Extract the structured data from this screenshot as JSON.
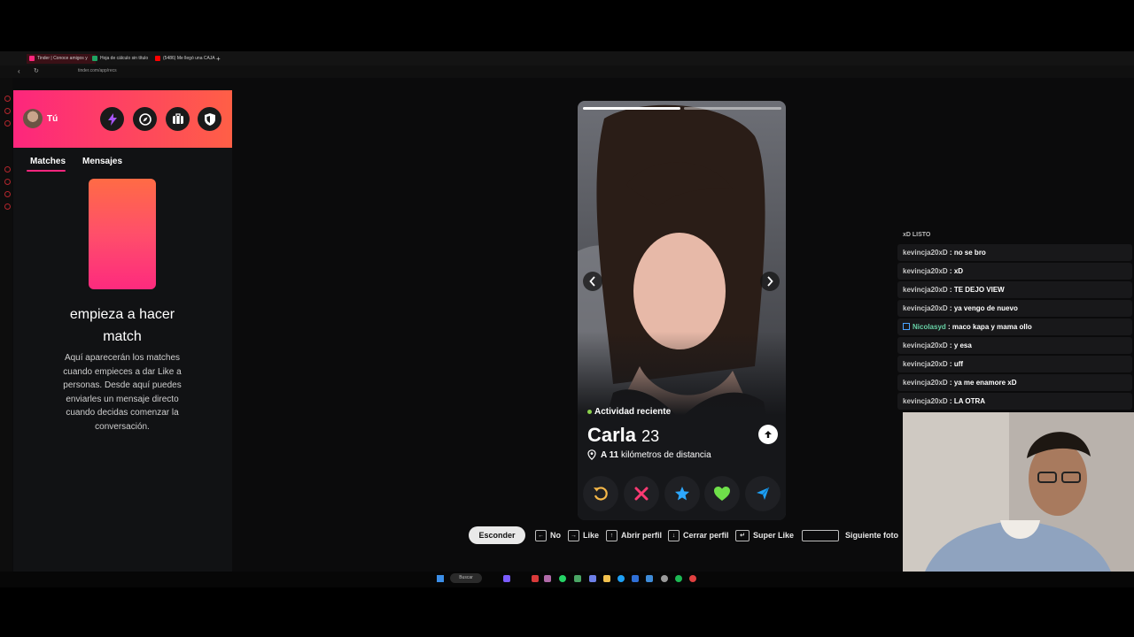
{
  "browser": {
    "tabs": [
      {
        "label": "Tinder | Conoce amigos y"
      },
      {
        "label": "Hoja de cálculo sin título"
      },
      {
        "label": "(5486) Me llegó una CAJA"
      }
    ],
    "new_tab": "+",
    "url": "tinder.com/app/recs"
  },
  "sidebar": {
    "profile_name": "Tú",
    "tabs": {
      "matches": "Matches",
      "messages": "Mensajes"
    },
    "empty_title": "empieza a hacer match",
    "empty_text": "Aquí aparecerán los matches cuando empieces a dar Like a personas. Desde aquí puedes enviarles un mensaje directo cuando decidas comenzar la conversación."
  },
  "profile": {
    "status": "Actividad reciente",
    "name": "Carla",
    "age": "23",
    "distance_prefix": "A",
    "distance_value": "11",
    "distance_suffix": "kilómetros de distancia",
    "photo_count": 2,
    "active_photo": 0
  },
  "shortcuts": {
    "hide": "Esconder",
    "no": "No",
    "like": "Like",
    "open_profile": "Abrir perfil",
    "close_profile": "Cerrar perfil",
    "super_like": "Super Like",
    "next_photo": "Siguiente foto"
  },
  "chat": {
    "partial_top": "xD LISTO",
    "messages": [
      {
        "user": "kevincja20xD",
        "text": "no se bro"
      },
      {
        "user": "kevincja20xD",
        "text": "xD"
      },
      {
        "user": "kevincja20xD",
        "text": "TE DEJO VIEW"
      },
      {
        "user": "kevincja20xD",
        "text": "ya vengo de nuevo"
      },
      {
        "user": "Nicolasyd",
        "text": "maco kapa y mama ollo"
      },
      {
        "user": "kevincja20xD",
        "text": "y esa"
      },
      {
        "user": "kevincja20xD",
        "text": "uff"
      },
      {
        "user": "kevincja20xD",
        "text": "ya me enamore xD"
      },
      {
        "user": "kevincja20xD",
        "text": "LA OTRA"
      }
    ]
  },
  "taskbar": {
    "search": "Buscar"
  },
  "colors": {
    "brand_pink": "#fd267d",
    "brand_orange": "#ff5f46",
    "online": "#8bd14c"
  },
  "icons": [
    "back-icon",
    "refresh-icon",
    "bolt-icon",
    "compass-icon",
    "briefcase-icon",
    "shield-icon",
    "location-pin-icon",
    "arrow-up-icon",
    "rewind-icon",
    "nope-icon",
    "star-icon",
    "heart-icon",
    "send-icon",
    "chevron-left-icon",
    "chevron-right-icon"
  ]
}
